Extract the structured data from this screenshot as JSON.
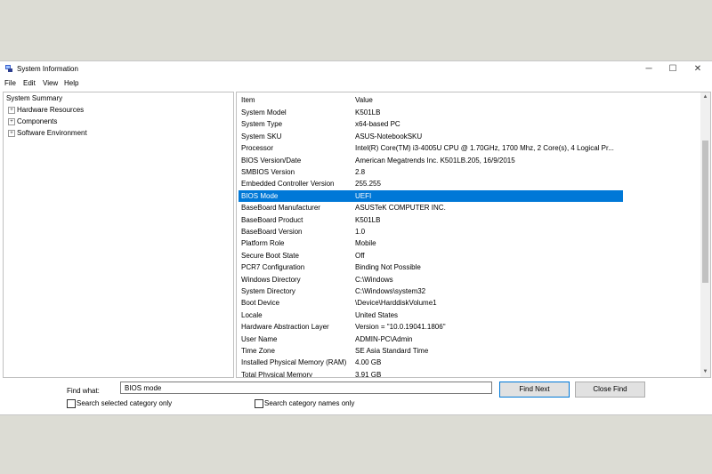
{
  "window": {
    "title": "System Information"
  },
  "titlebar_buttons": {
    "minimize": "─",
    "maximize": "☐",
    "close": "✕"
  },
  "menu": [
    "File",
    "Edit",
    "View",
    "Help"
  ],
  "tree": {
    "root": "System Summary",
    "children": [
      "Hardware Resources",
      "Components",
      "Software Environment"
    ]
  },
  "table": {
    "header": {
      "item": "Item",
      "value": "Value"
    },
    "rows": [
      {
        "item": "System Model",
        "value": "K501LB"
      },
      {
        "item": "System Type",
        "value": "x64-based PC"
      },
      {
        "item": "System SKU",
        "value": "ASUS-NotebookSKU"
      },
      {
        "item": "Processor",
        "value": "Intel(R) Core(TM) i3-4005U CPU @ 1.70GHz, 1700 Mhz, 2 Core(s), 4 Logical Pr..."
      },
      {
        "item": "BIOS Version/Date",
        "value": "American Megatrends Inc. K501LB.205, 16/9/2015"
      },
      {
        "item": "SMBIOS Version",
        "value": "2.8"
      },
      {
        "item": "Embedded Controller Version",
        "value": "255.255"
      },
      {
        "item": "BIOS Mode",
        "value": "UEFI"
      },
      {
        "item": "BaseBoard Manufacturer",
        "value": "ASUSTeK COMPUTER INC."
      },
      {
        "item": "BaseBoard Product",
        "value": "K501LB"
      },
      {
        "item": "BaseBoard Version",
        "value": "1.0"
      },
      {
        "item": "Platform Role",
        "value": "Mobile"
      },
      {
        "item": "Secure Boot State",
        "value": "Off"
      },
      {
        "item": "PCR7 Configuration",
        "value": "Binding Not Possible"
      },
      {
        "item": "Windows Directory",
        "value": "C:\\Windows"
      },
      {
        "item": "System Directory",
        "value": "C:\\Windows\\system32"
      },
      {
        "item": "Boot Device",
        "value": "\\Device\\HarddiskVolume1"
      },
      {
        "item": "Locale",
        "value": "United States"
      },
      {
        "item": "Hardware Abstraction Layer",
        "value": "Version = \"10.0.19041.1806\""
      },
      {
        "item": "User Name",
        "value": "ADMIN-PC\\Admin"
      },
      {
        "item": "Time Zone",
        "value": "SE Asia Standard Time"
      },
      {
        "item": "Installed Physical Memory (RAM)",
        "value": "4.00 GB"
      },
      {
        "item": "Total Physical Memory",
        "value": "3.91 GB"
      }
    ],
    "selected_index": 7
  },
  "find": {
    "label": "Find what:",
    "value": "BIOS mode",
    "find_next": "Find Next",
    "close_find": "Close Find",
    "option1": "Search selected category only",
    "option2": "Search category names only"
  },
  "colors": {
    "selection": "#0078d7",
    "background": "#dcdcd4"
  }
}
